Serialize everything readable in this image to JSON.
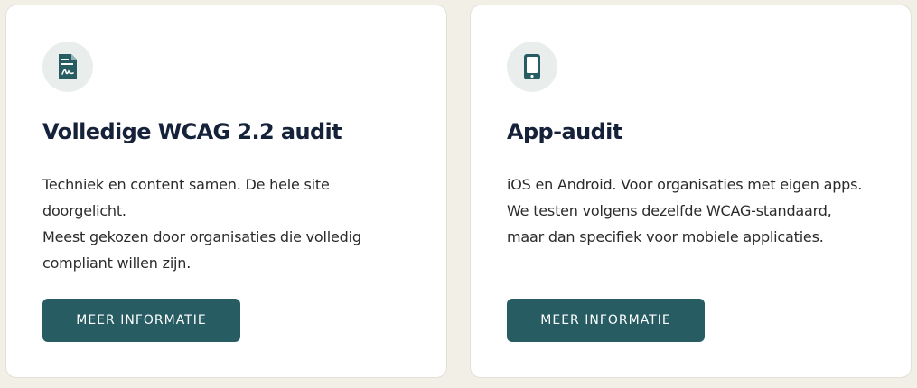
{
  "colors": {
    "page_background": "#f2efe6",
    "card_background": "#ffffff",
    "icon_background": "#e9eeec",
    "accent": "#275c63",
    "heading": "#16223a",
    "body_text": "#2b2b2b"
  },
  "cards": [
    {
      "icon": "document-signature-icon",
      "title": "Volledige WCAG 2.2 audit",
      "description_lines": [
        "Techniek en content samen. De hele site doorgelicht.",
        "Meest gekozen door organisaties die volledig compliant willen zijn."
      ],
      "button_label": "MEER INFORMATIE"
    },
    {
      "icon": "smartphone-icon",
      "title": "App-audit",
      "description_lines": [
        "iOS en Android. Voor organisaties met eigen apps. We testen volgens dezelfde WCAG-standaard, maar dan specifiek voor mobiele applicaties."
      ],
      "button_label": "MEER INFORMATIE"
    }
  ]
}
